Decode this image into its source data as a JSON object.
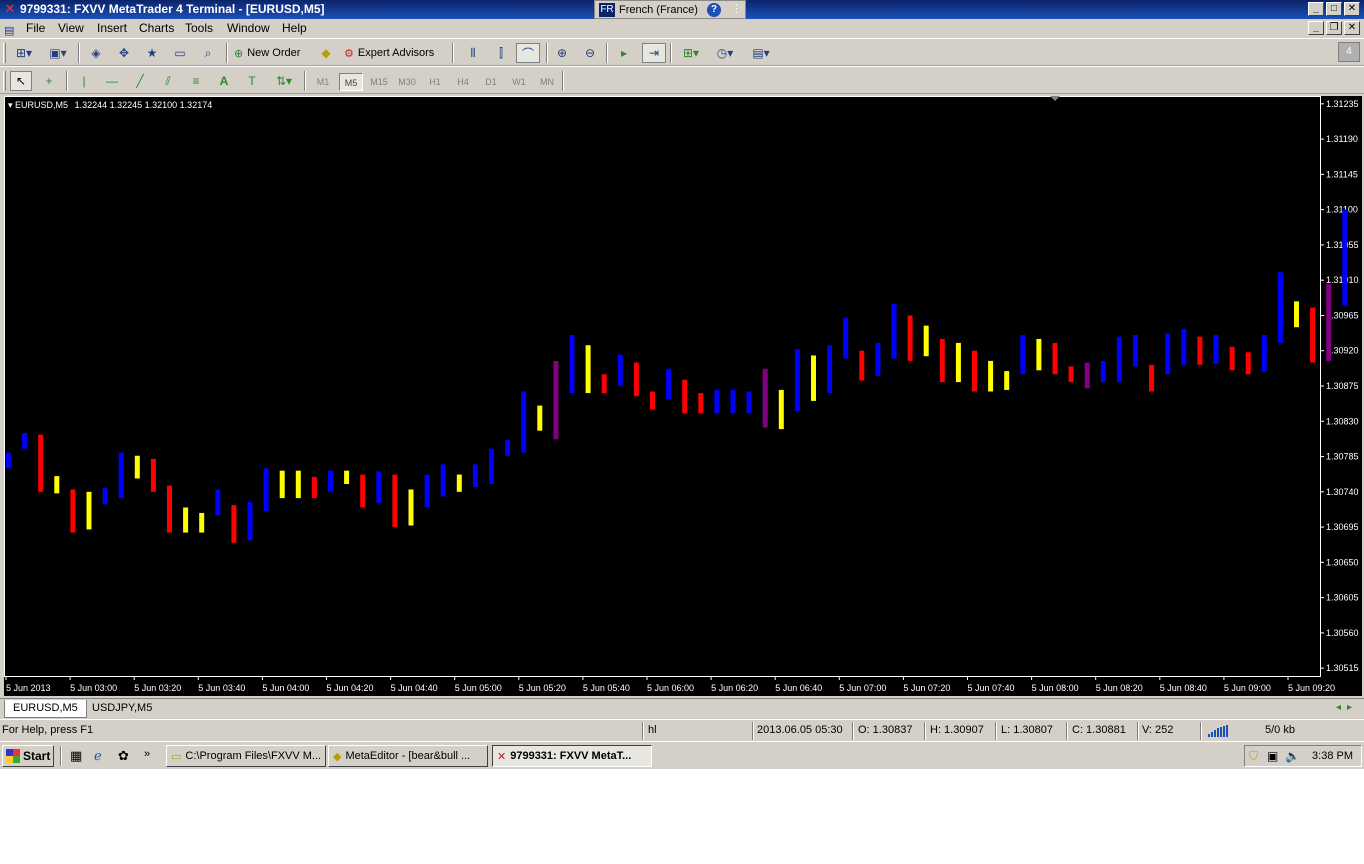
{
  "window": {
    "title": "9799331: FXVV MetaTrader 4 Terminal - [EURUSD,M5]",
    "language_code": "FR",
    "language_name": "French (France)"
  },
  "menu": [
    {
      "label": "File"
    },
    {
      "label": "View"
    },
    {
      "label": "Insert"
    },
    {
      "label": "Charts"
    },
    {
      "label": "Tools"
    },
    {
      "label": "Window"
    },
    {
      "label": "Help"
    }
  ],
  "toolbar": {
    "new_order": "New Order",
    "expert_advisors": "Expert Advisors",
    "timeframes": [
      "M1",
      "M5",
      "M15",
      "M30",
      "H1",
      "H4",
      "D1",
      "W1",
      "MN"
    ],
    "active_timeframe": "M5",
    "right_badge": "4"
  },
  "chart_header": {
    "symbol": "EURUSD,M5",
    "ohlc": "1.32244 1.32245 1.32100 1.32174"
  },
  "chart_data": {
    "type": "bar",
    "price_axis_labels": [
      "1.31235",
      "1.31190",
      "1.31145",
      "1.31100",
      "1.31055",
      "1.31010",
      "1.30965",
      "1.30920",
      "1.30875",
      "1.30830",
      "1.30785",
      "1.30740",
      "1.30695",
      "1.30650",
      "1.30605",
      "1.30560",
      "1.30515"
    ],
    "ylim": [
      1.30505,
      1.31245
    ],
    "time_axis_labels": [
      "5 Jun 2013",
      "5 Jun 03:00",
      "5 Jun 03:20",
      "5 Jun 03:40",
      "5 Jun 04:00",
      "5 Jun 04:20",
      "5 Jun 04:40",
      "5 Jun 05:00",
      "5 Jun 05:20",
      "5 Jun 05:40",
      "5 Jun 06:00",
      "5 Jun 06:20",
      "5 Jun 06:40",
      "5 Jun 07:00",
      "5 Jun 07:20",
      "5 Jun 07:40",
      "5 Jun 08:00",
      "5 Jun 08:20",
      "5 Jun 08:40",
      "5 Jun 09:00",
      "5 Jun 09:20"
    ],
    "colors": {
      "blue": "#0000ff",
      "red": "#ff0000",
      "yellow": "#ffff00",
      "purple": "#800080",
      "background": "#000000",
      "text": "#ffffff"
    },
    "bars": [
      {
        "high": 1.3079,
        "low": 1.3077,
        "color": "blue"
      },
      {
        "high": 1.30815,
        "low": 1.30795,
        "color": "blue"
      },
      {
        "high": 1.30813,
        "low": 1.3074,
        "color": "red"
      },
      {
        "high": 1.3076,
        "low": 1.30738,
        "color": "yellow"
      },
      {
        "high": 1.30743,
        "low": 1.30688,
        "color": "red"
      },
      {
        "high": 1.3074,
        "low": 1.30692,
        "color": "yellow"
      },
      {
        "high": 1.30745,
        "low": 1.30724,
        "color": "blue"
      },
      {
        "high": 1.3079,
        "low": 1.30732,
        "color": "blue"
      },
      {
        "high": 1.30786,
        "low": 1.30757,
        "color": "yellow"
      },
      {
        "high": 1.30782,
        "low": 1.3074,
        "color": "red"
      },
      {
        "high": 1.30748,
        "low": 1.30688,
        "color": "red"
      },
      {
        "high": 1.3072,
        "low": 1.30688,
        "color": "yellow"
      },
      {
        "high": 1.30713,
        "low": 1.30688,
        "color": "yellow"
      },
      {
        "high": 1.30743,
        "low": 1.3071,
        "color": "blue"
      },
      {
        "high": 1.30723,
        "low": 1.30675,
        "color": "red"
      },
      {
        "high": 1.30727,
        "low": 1.30678,
        "color": "blue"
      },
      {
        "high": 1.3077,
        "low": 1.30715,
        "color": "blue"
      },
      {
        "high": 1.30767,
        "low": 1.30732,
        "color": "yellow"
      },
      {
        "high": 1.30767,
        "low": 1.30732,
        "color": "yellow"
      },
      {
        "high": 1.30759,
        "low": 1.30732,
        "color": "red"
      },
      {
        "high": 1.30767,
        "low": 1.3074,
        "color": "blue"
      },
      {
        "high": 1.30767,
        "low": 1.3075,
        "color": "yellow"
      },
      {
        "high": 1.30762,
        "low": 1.3072,
        "color": "red"
      },
      {
        "high": 1.30766,
        "low": 1.30726,
        "color": "blue"
      },
      {
        "high": 1.30762,
        "low": 1.30695,
        "color": "red"
      },
      {
        "high": 1.30743,
        "low": 1.30697,
        "color": "yellow"
      },
      {
        "high": 1.30762,
        "low": 1.3072,
        "color": "blue"
      },
      {
        "high": 1.30775,
        "low": 1.30734,
        "color": "blue"
      },
      {
        "high": 1.30762,
        "low": 1.3074,
        "color": "yellow"
      },
      {
        "high": 1.30775,
        "low": 1.30746,
        "color": "blue"
      },
      {
        "high": 1.30795,
        "low": 1.3075,
        "color": "blue"
      },
      {
        "high": 1.30806,
        "low": 1.30786,
        "color": "blue"
      },
      {
        "high": 1.30868,
        "low": 1.3079,
        "color": "blue"
      },
      {
        "high": 1.3085,
        "low": 1.30818,
        "color": "yellow"
      },
      {
        "high": 1.30907,
        "low": 1.30807,
        "color": "purple"
      },
      {
        "high": 1.3094,
        "low": 1.30866,
        "color": "blue"
      },
      {
        "high": 1.30927,
        "low": 1.30866,
        "color": "yellow"
      },
      {
        "high": 1.3089,
        "low": 1.30866,
        "color": "red"
      },
      {
        "high": 1.30915,
        "low": 1.30875,
        "color": "blue"
      },
      {
        "high": 1.30905,
        "low": 1.30862,
        "color": "red"
      },
      {
        "high": 1.30868,
        "low": 1.30845,
        "color": "red"
      },
      {
        "high": 1.30897,
        "low": 1.30858,
        "color": "blue"
      },
      {
        "high": 1.30883,
        "low": 1.3084,
        "color": "red"
      },
      {
        "high": 1.30866,
        "low": 1.3084,
        "color": "red"
      },
      {
        "high": 1.3087,
        "low": 1.3084,
        "color": "blue"
      },
      {
        "high": 1.3087,
        "low": 1.3084,
        "color": "blue"
      },
      {
        "high": 1.30868,
        "low": 1.3084,
        "color": "blue"
      },
      {
        "high": 1.30897,
        "low": 1.30822,
        "color": "purple"
      },
      {
        "high": 1.3087,
        "low": 1.3082,
        "color": "yellow"
      },
      {
        "high": 1.30922,
        "low": 1.30843,
        "color": "blue"
      },
      {
        "high": 1.30914,
        "low": 1.30856,
        "color": "yellow"
      },
      {
        "high": 1.30927,
        "low": 1.30866,
        "color": "blue"
      },
      {
        "high": 1.30962,
        "low": 1.3091,
        "color": "blue"
      },
      {
        "high": 1.3092,
        "low": 1.30882,
        "color": "red"
      },
      {
        "high": 1.3093,
        "low": 1.30888,
        "color": "blue"
      },
      {
        "high": 1.3098,
        "low": 1.3091,
        "color": "blue"
      },
      {
        "high": 1.30965,
        "low": 1.30907,
        "color": "red"
      },
      {
        "high": 1.30952,
        "low": 1.30913,
        "color": "yellow"
      },
      {
        "high": 1.30935,
        "low": 1.3088,
        "color": "red"
      },
      {
        "high": 1.3093,
        "low": 1.3088,
        "color": "yellow"
      },
      {
        "high": 1.3092,
        "low": 1.30868,
        "color": "red"
      },
      {
        "high": 1.30907,
        "low": 1.30868,
        "color": "yellow"
      },
      {
        "high": 1.30894,
        "low": 1.3087,
        "color": "yellow"
      },
      {
        "high": 1.3094,
        "low": 1.3089,
        "color": "blue"
      },
      {
        "high": 1.30935,
        "low": 1.30895,
        "color": "yellow"
      },
      {
        "high": 1.3093,
        "low": 1.3089,
        "color": "red"
      },
      {
        "high": 1.309,
        "low": 1.3088,
        "color": "red"
      },
      {
        "high": 1.30905,
        "low": 1.30872,
        "color": "purple"
      },
      {
        "high": 1.30907,
        "low": 1.3088,
        "color": "blue"
      },
      {
        "high": 1.30938,
        "low": 1.3088,
        "color": "blue"
      },
      {
        "high": 1.3094,
        "low": 1.309,
        "color": "blue"
      },
      {
        "high": 1.30902,
        "low": 1.30868,
        "color": "red"
      },
      {
        "high": 1.30942,
        "low": 1.3089,
        "color": "blue"
      },
      {
        "high": 1.30948,
        "low": 1.30902,
        "color": "blue"
      },
      {
        "high": 1.30938,
        "low": 1.30902,
        "color": "red"
      },
      {
        "high": 1.3094,
        "low": 1.30903,
        "color": "blue"
      },
      {
        "high": 1.30925,
        "low": 1.30895,
        "color": "red"
      },
      {
        "high": 1.30918,
        "low": 1.3089,
        "color": "red"
      },
      {
        "high": 1.3094,
        "low": 1.30893,
        "color": "blue"
      },
      {
        "high": 1.3102,
        "low": 1.3093,
        "color": "blue"
      },
      {
        "high": 1.30983,
        "low": 1.3095,
        "color": "yellow"
      },
      {
        "high": 1.30975,
        "low": 1.30905,
        "color": "red"
      },
      {
        "high": 1.31005,
        "low": 1.30907,
        "color": "purple"
      },
      {
        "high": 1.311,
        "low": 1.30978,
        "color": "blue"
      }
    ]
  },
  "tabs": [
    {
      "label": "EURUSD,M5",
      "active": true
    },
    {
      "label": "USDJPY,M5",
      "active": false
    }
  ],
  "status": {
    "help_text": "For Help, press F1",
    "profile": "hl",
    "datetime": "2013.06.05 05:30",
    "open": "O: 1.30837",
    "high": "H: 1.30907",
    "low": "L: 1.30807",
    "close": "C: 1.30881",
    "volume": "V: 252",
    "traffic": "5/0 kb"
  },
  "taskbar": {
    "start_label": "Start",
    "tasks": [
      {
        "label": "C:\\Program Files\\FXVV M...",
        "active": false
      },
      {
        "label": "MetaEditor - [bear&bull ...",
        "active": false
      },
      {
        "label": "9799331: FXVV MetaT...",
        "active": true
      }
    ],
    "clock": "3:38 PM"
  }
}
